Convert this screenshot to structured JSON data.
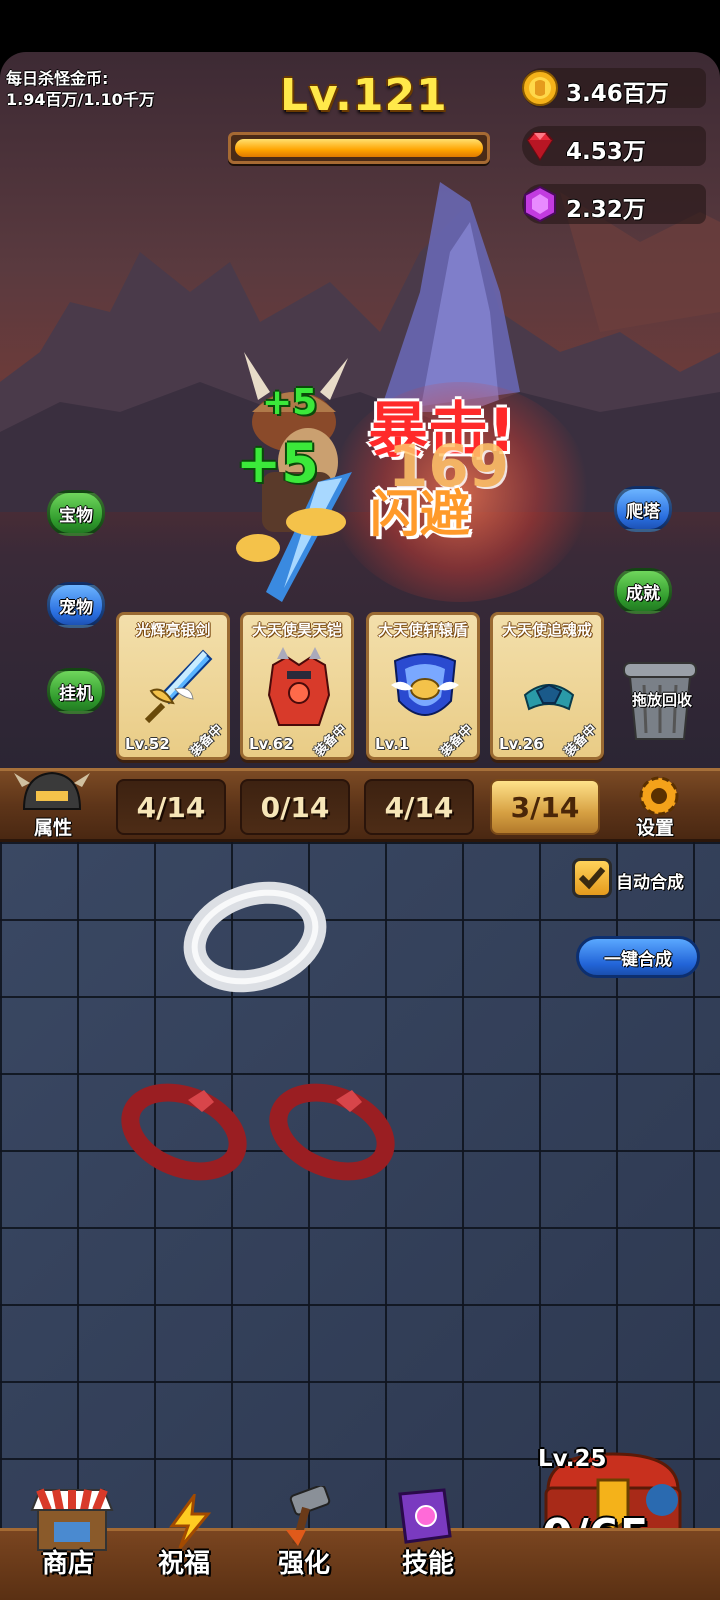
{
  "header": {
    "daily_gold_label": "每日杀怪金币:",
    "daily_gold_value": "1.94百万/1.10千万",
    "level": "Lv.121",
    "level_progress": 1.0
  },
  "resources": [
    {
      "icon": "gold-coin-icon",
      "value": "3.46百万",
      "color": "#f4b21a"
    },
    {
      "icon": "ruby-icon",
      "value": "4.53万",
      "color": "#e8293a"
    },
    {
      "icon": "purple-gem-icon",
      "value": "2.32万",
      "color": "#c23be0"
    }
  ],
  "side_buttons": {
    "treasure": "宝物",
    "pet": "宠物",
    "idle": "挂机",
    "tower": "爬塔",
    "achievement": "成就"
  },
  "battle_fx": {
    "plus_top": "+5",
    "plus_mid": "+5",
    "crit": "暴击!",
    "num": "169",
    "dodge": "闪避"
  },
  "equipment": [
    {
      "name": "光辉亮银剑",
      "level": "Lv.52",
      "status": "装备中"
    },
    {
      "name": "大天使昊天铠",
      "level": "Lv.62",
      "status": "装备中"
    },
    {
      "name": "大天使轩辕盾",
      "level": "Lv.1",
      "status": "装备中"
    },
    {
      "name": "大天使追魂戒",
      "level": "Lv.26",
      "status": "装备中"
    }
  ],
  "trash_label": "拖放回收",
  "tabs": {
    "attributes": "属性",
    "slots": [
      "4/14",
      "0/14",
      "4/14",
      "3/14"
    ],
    "active_index": 3,
    "settings": "设置"
  },
  "merge": {
    "auto_merge": "自动合成",
    "auto_merge_checked": true,
    "one_click": "一键合成"
  },
  "chest": {
    "level": "Lv.25",
    "count": "0/65"
  },
  "nav": {
    "shop": "商店",
    "blessing": "祝福",
    "enhance": "强化",
    "skills": "技能"
  },
  "colors": {
    "level_text": "#ffe94a",
    "plus_green": "#3be93a",
    "crit_red": "#ff2a2a",
    "dodge_orange": "#ffb43a"
  }
}
